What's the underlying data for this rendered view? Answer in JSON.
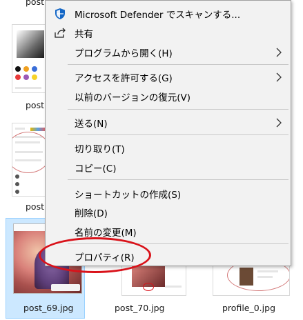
{
  "background": {
    "file_labels": {
      "top_left_cut": "post",
      "row2_left_cut": "post",
      "row3_left_cut": "post",
      "row4_left_cut": "post",
      "selected": "post_69.jpg",
      "middle": "post_70.jpg",
      "right": "profile_0.jpg"
    }
  },
  "context_menu": {
    "items": [
      {
        "label": "Microsoft Defender でスキャンする...",
        "icon": "defender-shield-icon"
      },
      {
        "label": "共有",
        "icon": "share-icon"
      },
      {
        "label": "プログラムから開く(H)",
        "icon": "",
        "submenu": true
      },
      {
        "label": "アクセスを許可する(G)",
        "icon": "",
        "submenu": true
      },
      {
        "label": "以前のバージョンの復元(V)",
        "icon": ""
      },
      {
        "label": "送る(N)",
        "icon": "",
        "submenu": true
      },
      {
        "label": "切り取り(T)",
        "icon": ""
      },
      {
        "label": "コピー(C)",
        "icon": ""
      },
      {
        "label": "ショートカットの作成(S)",
        "icon": ""
      },
      {
        "label": "削除(D)",
        "icon": ""
      },
      {
        "label": "名前の変更(M)",
        "icon": ""
      },
      {
        "label": "プロパティ(R)",
        "icon": ""
      }
    ]
  },
  "colors": {
    "menu_bg": "#f2f2f2",
    "selection_bg": "#cce8ff",
    "annotation_red": "#d9121a",
    "defender_blue": "#1467c6"
  }
}
